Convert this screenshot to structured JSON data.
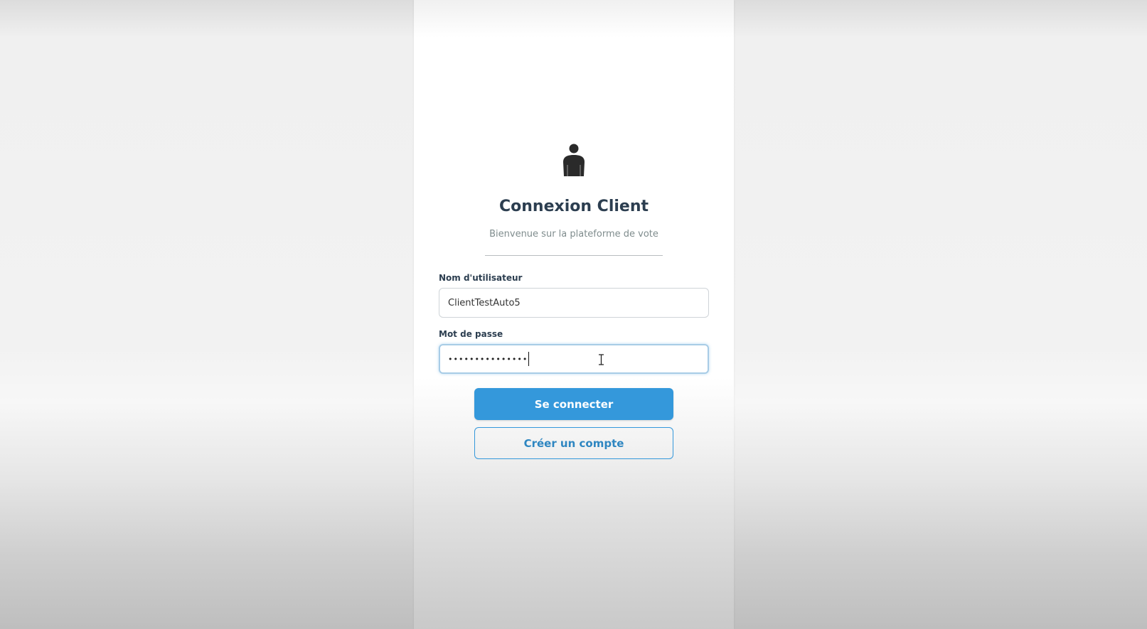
{
  "login": {
    "title": "Connexion Client",
    "subtitle": "Bienvenue sur la plateforme de vote",
    "username_label": "Nom d'utilisateur",
    "username_value": "ClientTestAuto5",
    "password_label": "Mot de passe",
    "password_masked": "•••••••••••••••",
    "login_button": "Se connecter",
    "create_account_button": "Créer un compte",
    "avatar_icon": "user-icon"
  },
  "colors": {
    "primary": "#3498db",
    "title": "#2c3e50",
    "subtitle": "#7f8c8d"
  }
}
